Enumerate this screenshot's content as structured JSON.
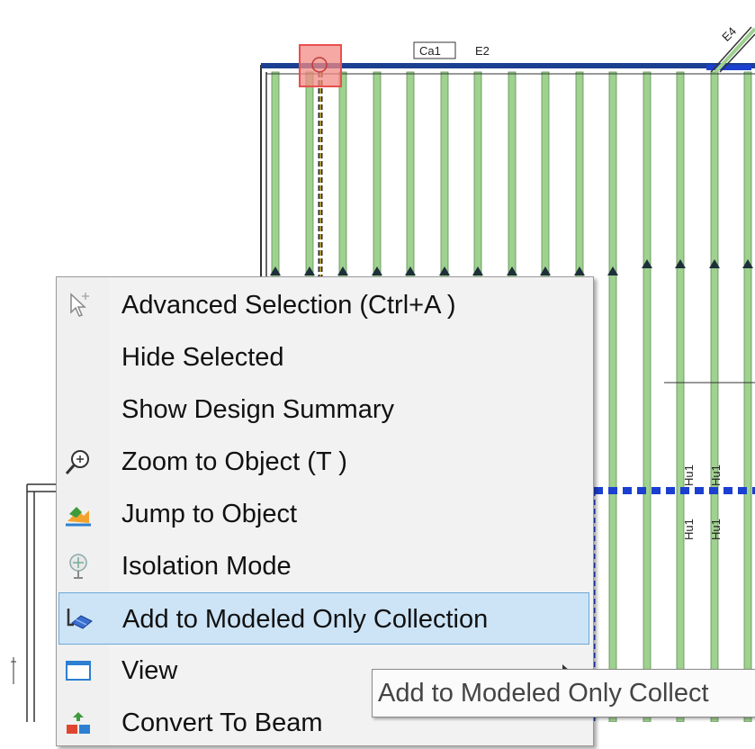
{
  "drawing": {
    "labels": {
      "ca1": "Ca1",
      "e2": "E2",
      "e4": "E4",
      "hu_a": "Hu1",
      "hu_b": "Hu1",
      "hu_c": "Hu1",
      "hu_d": "Hu1"
    },
    "colors": {
      "joist": "#9fd18f",
      "beam": "#1b3f91",
      "selected_member": "#2b2b2b",
      "highlight": "#e8504d",
      "wall": "#333333"
    }
  },
  "context_menu": {
    "items": [
      {
        "label": "Advanced Selection (Ctrl+A )",
        "icon": "selection-cursor-icon"
      },
      {
        "label": "Hide Selected",
        "icon": ""
      },
      {
        "label": "Show Design Summary",
        "icon": ""
      },
      {
        "label": "Zoom to Object (T )",
        "icon": "magnifier-icon"
      },
      {
        "label": "Jump to Object",
        "icon": "jump-arrow-icon"
      },
      {
        "label": "Isolation Mode",
        "icon": "isolation-icon"
      },
      {
        "label": "Add to Modeled Only Collection",
        "icon": "collection-icon",
        "highlighted": true
      },
      {
        "label": "View",
        "icon": "window-icon",
        "has_submenu": true
      },
      {
        "label": "Convert To Beam",
        "icon": "convert-icon"
      }
    ]
  },
  "tooltip": {
    "text": "Add to Modeled Only Collect"
  }
}
